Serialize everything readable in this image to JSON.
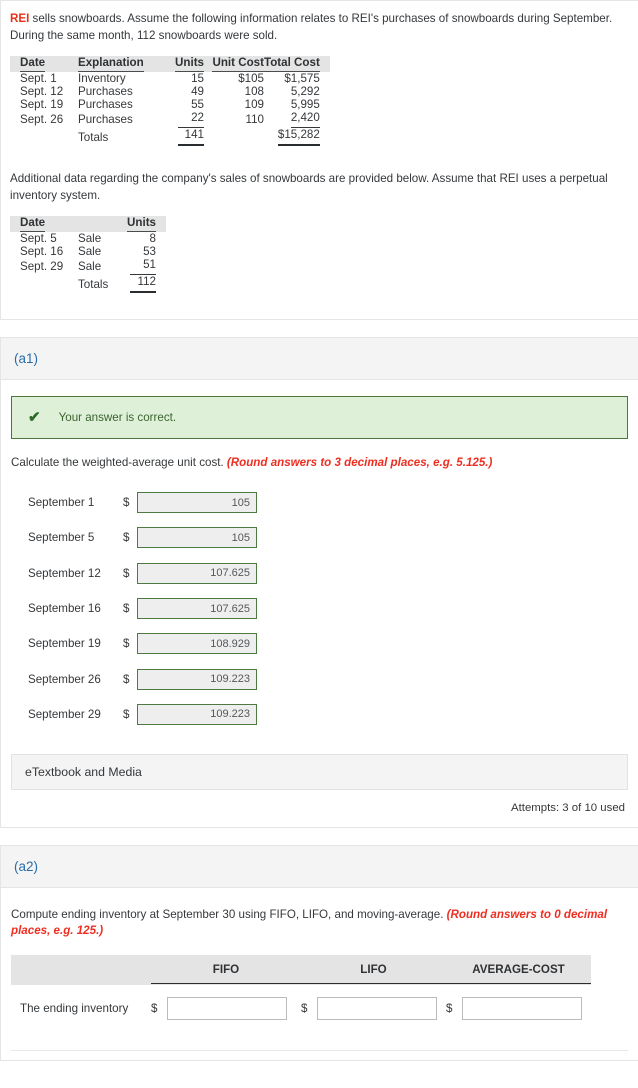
{
  "intro": {
    "brand": "REI",
    "paragraph1": " sells snowboards. Assume the following information relates to REI's purchases of snowboards during September. During the same month, 112 snowboards were sold.",
    "paragraph2": "Additional data regarding the company's sales of snowboards are provided below. Assume that REI uses a perpetual inventory system."
  },
  "purchases_table": {
    "headers": [
      "Date",
      "Explanation",
      "Units",
      "Unit Cost",
      "Total Cost"
    ],
    "rows": [
      {
        "date": "Sept. 1",
        "explanation": "Inventory",
        "units": "15",
        "unit_cost": "$105",
        "total_cost": "$1,575"
      },
      {
        "date": "Sept. 12",
        "explanation": "Purchases",
        "units": "49",
        "unit_cost": "108",
        "total_cost": "5,292"
      },
      {
        "date": "Sept. 19",
        "explanation": "Purchases",
        "units": "55",
        "unit_cost": "109",
        "total_cost": "5,995"
      },
      {
        "date": "Sept. 26",
        "explanation": "Purchases",
        "units": "22",
        "unit_cost": "110",
        "total_cost": "2,420"
      }
    ],
    "totals": {
      "label": "Totals",
      "units": "141",
      "total_cost": "$15,282"
    }
  },
  "sales_table": {
    "headers": [
      "Date",
      "",
      "Units"
    ],
    "rows": [
      {
        "date": "Sept. 5",
        "explanation": "Sale",
        "units": "8"
      },
      {
        "date": "Sept. 16",
        "explanation": "Sale",
        "units": "53"
      },
      {
        "date": "Sept. 29",
        "explanation": "Sale",
        "units": "51"
      }
    ],
    "totals": {
      "label": "Totals",
      "units": "112"
    }
  },
  "a1": {
    "section_label": "(a1)",
    "alert": {
      "icon": "check-icon",
      "text": "Your answer is correct."
    },
    "prompt": "Calculate the weighted-average unit cost. ",
    "prompt_hint": "(Round answers to 3 decimal places, e.g. 5.125.)",
    "currency_symbol": "$",
    "rows": [
      {
        "label": "September 1",
        "value": "105"
      },
      {
        "label": "September 5",
        "value": "105"
      },
      {
        "label": "September 12",
        "value": "107.625"
      },
      {
        "label": "September 16",
        "value": "107.625"
      },
      {
        "label": "September 19",
        "value": "108.929"
      },
      {
        "label": "September 26",
        "value": "109.223"
      },
      {
        "label": "September 29",
        "value": "109.223"
      }
    ],
    "etextbook_label": "eTextbook and Media",
    "attempts": "Attempts: 3 of 10 used"
  },
  "a2": {
    "section_label": "(a2)",
    "prompt": "Compute ending inventory at September 30 using FIFO, LIFO, and moving-average. ",
    "prompt_hint": "(Round answers to 0 decimal places, e.g. 125.)",
    "headers": [
      "",
      "FIFO",
      "LIFO",
      "AVERAGE-COST"
    ],
    "row_label": "The ending inventory",
    "currency_symbol": "$",
    "values": [
      "",
      "",
      ""
    ],
    "placeholder": ""
  },
  "colors": {
    "brand_red": "#e8311b",
    "section_link": "#2a6ca8",
    "alert_bg": "#dff0d8",
    "alert_border": "#4b763f",
    "hint_red": "#ee2e21",
    "input_correct_border": "#4d7a41",
    "table_header_bg": "#e4e4e4"
  }
}
